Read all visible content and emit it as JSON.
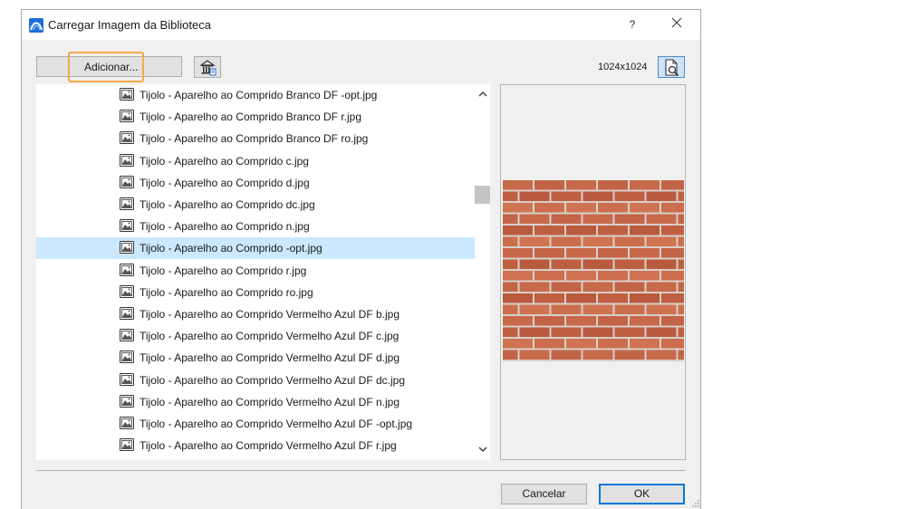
{
  "window": {
    "title": "Carregar Imagem da Biblioteca",
    "help_label": "?",
    "icons": {
      "app": "archicad-icon",
      "close": "close-icon"
    }
  },
  "toolbar": {
    "add_label": "Adicionar...",
    "library_icon": "library-manager-icon",
    "image_size": "1024x1024",
    "preview_icon": "preview-zoom-icon"
  },
  "files": [
    {
      "name": "Tijolo - Aparelho ao Comprido Branco DF -opt.jpg",
      "selected": false
    },
    {
      "name": "Tijolo - Aparelho ao Comprido Branco DF r.jpg",
      "selected": false
    },
    {
      "name": "Tijolo - Aparelho ao Comprido Branco DF ro.jpg",
      "selected": false
    },
    {
      "name": "Tijolo - Aparelho ao Comprido c.jpg",
      "selected": false
    },
    {
      "name": "Tijolo - Aparelho ao Comprido d.jpg",
      "selected": false
    },
    {
      "name": "Tijolo - Aparelho ao Comprido dc.jpg",
      "selected": false
    },
    {
      "name": "Tijolo - Aparelho ao Comprido n.jpg",
      "selected": false
    },
    {
      "name": "Tijolo - Aparelho ao Comprido -opt.jpg",
      "selected": true
    },
    {
      "name": "Tijolo - Aparelho ao Comprido r.jpg",
      "selected": false
    },
    {
      "name": "Tijolo - Aparelho ao Comprido ro.jpg",
      "selected": false
    },
    {
      "name": "Tijolo - Aparelho ao Comprido Vermelho Azul DF b.jpg",
      "selected": false
    },
    {
      "name": "Tijolo - Aparelho ao Comprido Vermelho Azul DF c.jpg",
      "selected": false
    },
    {
      "name": "Tijolo - Aparelho ao Comprido Vermelho Azul DF d.jpg",
      "selected": false
    },
    {
      "name": "Tijolo - Aparelho ao Comprido Vermelho Azul DF dc.jpg",
      "selected": false
    },
    {
      "name": "Tijolo - Aparelho ao Comprido Vermelho Azul DF n.jpg",
      "selected": false
    },
    {
      "name": "Tijolo - Aparelho ao Comprido Vermelho Azul DF -opt.jpg",
      "selected": false
    },
    {
      "name": "Tijolo - Aparelho ao Comprido Vermelho Azul DF r.jpg",
      "selected": false
    }
  ],
  "file_icon": "image-file-icon",
  "preview": {
    "texture": "brick-texture-preview"
  },
  "footer": {
    "cancel_label": "Cancelar",
    "ok_label": "OK"
  },
  "colors": {
    "selection": "#cce8ff",
    "focus_ring": "#f5a94a",
    "ok_border": "#0078d7",
    "brick": "#c8694a",
    "mortar": "#d9cfc8"
  }
}
